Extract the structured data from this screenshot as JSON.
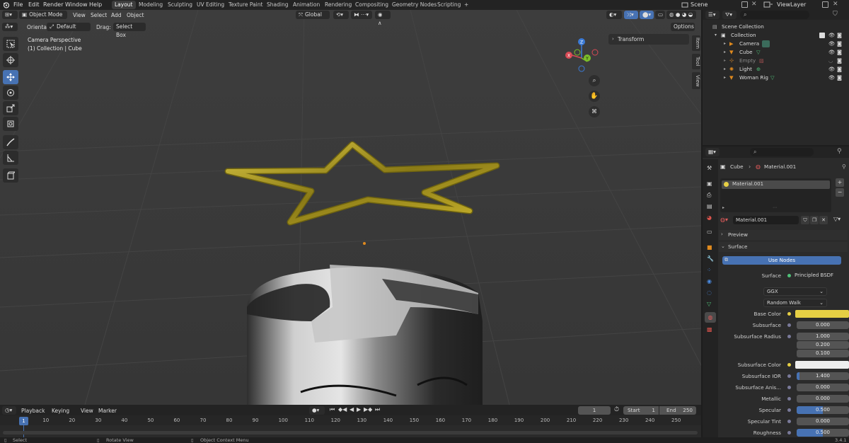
{
  "menu": {
    "items": [
      "File",
      "Edit",
      "Render",
      "Window",
      "Help"
    ],
    "workspace_tabs": [
      "Layout",
      "Modeling",
      "Sculpting",
      "UV Editing",
      "Texture Paint",
      "Shading",
      "Animation",
      "Rendering",
      "Compositing",
      "Geometry Nodes",
      "Scripting"
    ],
    "add_tab": "+",
    "scene_label": "Scene",
    "viewlayer_label": "ViewLayer"
  },
  "viewport_header": {
    "mode": "Object Mode",
    "menus": [
      "View",
      "Select",
      "Add",
      "Object"
    ],
    "transform": "Global",
    "options": "Options",
    "orientation_label": "Orientation:",
    "orientation_value": "Default",
    "drag_label": "Drag:",
    "drag_value": "Select Box"
  },
  "viewport": {
    "camera_text": "Camera Perspective",
    "collection_text": "(1) Collection | Cube",
    "transform_panel": "Transform",
    "side_tabs": [
      "Item",
      "Tool",
      "View"
    ],
    "gizmo": {
      "z": "Z",
      "x": "X",
      "y": "Y"
    },
    "accent_colors": {
      "star": "#b8a520",
      "origin": "#e08a1e"
    }
  },
  "outliner": {
    "search_placeholder": "",
    "root": "Scene Collection",
    "collection": "Collection",
    "items": [
      {
        "name": "Camera",
        "icon": "camera-icon",
        "dim": false
      },
      {
        "name": "Cube",
        "icon": "mesh-icon",
        "dim": false
      },
      {
        "name": "Empty",
        "icon": "empty-icon",
        "dim": true
      },
      {
        "name": "Light",
        "icon": "light-icon",
        "dim": false
      },
      {
        "name": "Woman Rig",
        "icon": "armature-icon",
        "dim": false
      }
    ]
  },
  "properties": {
    "breadcrumb_object": "Cube",
    "breadcrumb_material": "Material.001",
    "slot": "Material.001",
    "material_name": "Material.001",
    "preview": "Preview",
    "surface_section": "Surface",
    "use_nodes": "Use Nodes",
    "surface_label": "Surface",
    "surface_value": "Principled BSDF",
    "distribution": "GGX",
    "subsurface_method": "Random Walk",
    "base_color_label": "Base Color",
    "base_color": "#e6cf44",
    "rows": [
      {
        "label": "Subsurface",
        "value": "0.000"
      },
      {
        "label": "Subsurface Radius",
        "value": "1.000"
      },
      {
        "label": "",
        "value": "0.200"
      },
      {
        "label": "",
        "value": "0.100"
      }
    ],
    "subsurface_color_label": "Subsurface Color",
    "subsurface_color": "#eeeeee",
    "rows2": [
      {
        "label": "Subsurface IOR",
        "value": "1.400",
        "fill": 0.06
      },
      {
        "label": "Subsurface Anis...",
        "value": "0.000",
        "fill": 0
      },
      {
        "label": "Metallic",
        "value": "0.000",
        "fill": 0
      },
      {
        "label": "Specular",
        "value": "0.500",
        "fill": 0.5
      },
      {
        "label": "Specular Tint",
        "value": "0.000",
        "fill": 0
      },
      {
        "label": "Roughness",
        "value": "0.500",
        "fill": 0.5
      }
    ]
  },
  "timeline": {
    "menus": [
      "Playback",
      "Keying",
      "View",
      "Marker"
    ],
    "current_frame": "1",
    "start_label": "Start",
    "start": "1",
    "end_label": "End",
    "end": "250",
    "ruler": [
      "1",
      "10",
      "20",
      "30",
      "40",
      "50",
      "60",
      "70",
      "80",
      "90",
      "100",
      "110",
      "120",
      "130",
      "140",
      "150",
      "160",
      "170",
      "180",
      "190",
      "200",
      "210",
      "220",
      "230",
      "240",
      "250"
    ]
  },
  "status": {
    "select": "Select",
    "rotate": "Rotate View",
    "context": "Object Context Menu",
    "version": "3.4.1"
  }
}
